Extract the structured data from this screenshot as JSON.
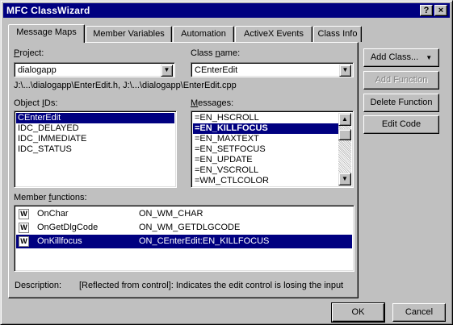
{
  "window": {
    "title": "MFC ClassWizard",
    "help_button": "?",
    "close_button": "×"
  },
  "tabs": [
    {
      "label": "Message Maps",
      "active": true
    },
    {
      "label": "Member Variables",
      "active": false
    },
    {
      "label": "Automation",
      "active": false
    },
    {
      "label": "ActiveX Events",
      "active": false
    },
    {
      "label": "Class Info",
      "active": false
    }
  ],
  "project": {
    "label_accel": "P",
    "label_rest": "roject:",
    "value": "dialogapp"
  },
  "class_name": {
    "label_pre": "Class ",
    "label_accel": "n",
    "label_rest": "ame:",
    "value": "CEnterEdit"
  },
  "file_paths": "J:\\...\\dialogapp\\EnterEdit.h, J:\\...\\dialogapp\\EnterEdit.cpp",
  "object_ids": {
    "label_pre": "Object ",
    "label_accel": "I",
    "label_rest": "Ds:",
    "items": [
      "CEnterEdit",
      "IDC_DELAYED",
      "IDC_IMMEDIATE",
      "IDC_STATUS"
    ],
    "selected_index": 0
  },
  "messages": {
    "label_accel": "M",
    "label_rest": "essages:",
    "items": [
      "=EN_HSCROLL",
      "=EN_KILLFOCUS",
      "=EN_MAXTEXT",
      "=EN_SETFOCUS",
      "=EN_UPDATE",
      "=EN_VSCROLL",
      "=WM_CTLCOLOR"
    ],
    "selected_index": 1
  },
  "member_functions": {
    "label_pre": "Member ",
    "label_accel": "f",
    "label_rest": "unctions:",
    "icon_text": "W",
    "rows": [
      {
        "name": "OnChar",
        "map": "ON_WM_CHAR"
      },
      {
        "name": "OnGetDlgCode",
        "map": "ON_WM_GETDLGCODE"
      },
      {
        "name": "OnKillfocus",
        "map": "ON_CEnterEdit:EN_KILLFOCUS"
      }
    ],
    "selected_index": 2
  },
  "description": {
    "label": "Description:",
    "text": "[Reflected from control]: Indicates the edit control is losing the input"
  },
  "buttons": {
    "add_class": "Add Class...",
    "add_class_arrow": "▼",
    "add_function": "Add Function",
    "delete_function": "Delete Function",
    "edit_code": "Edit Code",
    "ok": "OK",
    "cancel": "Cancel"
  },
  "colors": {
    "face": "#c0c0c0",
    "title_bar": "#000080",
    "selection": "#000080",
    "disabled_text": "#808080"
  }
}
